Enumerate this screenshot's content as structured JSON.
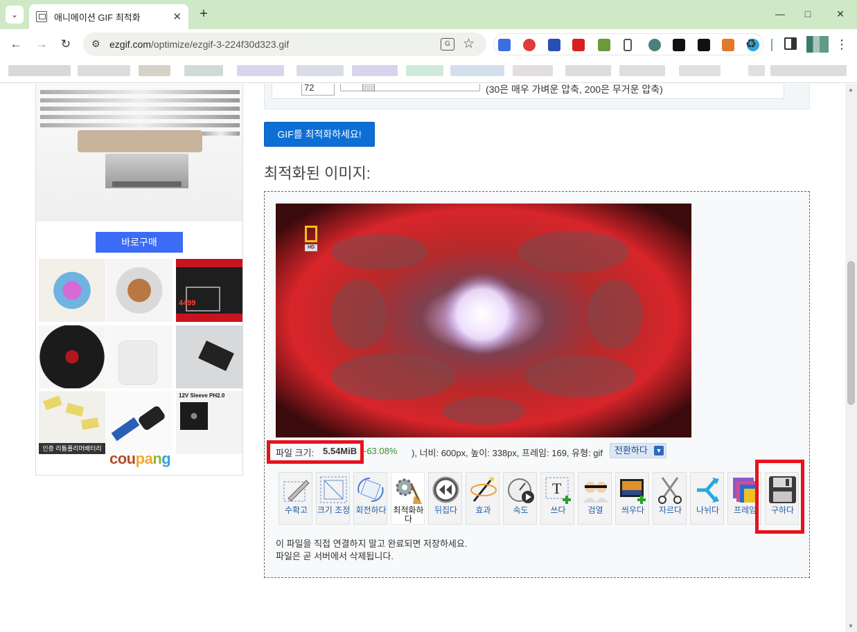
{
  "browser": {
    "tab_title": "애니메이션 GIF 최적화",
    "url_host": "ezgif.com",
    "url_path": "/optimize/ezgif-3-224f30d323.gif"
  },
  "page": {
    "ad": {
      "buy_button": "바로구매",
      "coupang": "coupang",
      "thumb_12v": "12V Sleeve PH2.0",
      "thumb_battery": "인증 리튬폴리머배터리",
      "thumb_price": "4499"
    },
    "settings": {
      "level_value": "72",
      "level_hint": "(30은 매우 가벼운 압축, 200은 무거운 압축)",
      "level_fraction": 0.17
    },
    "optimize_button": "GIF를 최적화하세요!",
    "result_heading": "최적화된 이미지:",
    "file_info": {
      "size_label": "파일 크기:",
      "size_value": "5.54MiB",
      "percent": "-63.08%",
      "rest": "), 너비: 600px, 높이: 338px, 프레임: 169, 유형: gif",
      "convert": "전환하다"
    },
    "tools": [
      {
        "label": "수확고",
        "icon": "crop-icon"
      },
      {
        "label": "크기 조정",
        "icon": "resize-icon"
      },
      {
        "label": "회전하다",
        "icon": "rotate-icon"
      },
      {
        "label": "최적화하다",
        "icon": "optimize-icon"
      },
      {
        "label": "뒤집다",
        "icon": "reverse-icon"
      },
      {
        "label": "효과",
        "icon": "effects-icon"
      },
      {
        "label": "속도",
        "icon": "speed-icon"
      },
      {
        "label": "쓰다",
        "icon": "write-text-icon"
      },
      {
        "label": "검열",
        "icon": "censor-icon"
      },
      {
        "label": "씌우다",
        "icon": "overlay-icon"
      },
      {
        "label": "자르다",
        "icon": "cut-icon"
      },
      {
        "label": "나뉘다",
        "icon": "split-icon"
      },
      {
        "label": "프레임",
        "icon": "frames-icon"
      },
      {
        "label": "구하다",
        "icon": "save-icon"
      }
    ],
    "notice_line1": "이 파일을 직접 연결하지 말고 완료되면 저장하세요.",
    "notice_line2": "파일은 곧 서버에서 삭제됩니다."
  }
}
